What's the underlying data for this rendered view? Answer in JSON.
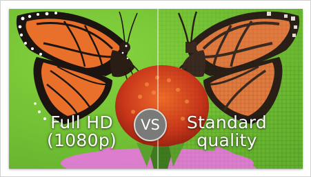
{
  "comparison": {
    "left_label_line1": "Full HD",
    "left_label_line2": "(1080p)",
    "badge": "VS",
    "right_label_line1": "Standard",
    "right_label_line2": "quality"
  },
  "colors": {
    "background_green": "#78c83a",
    "wing_orange": "#e8702a",
    "wing_black": "#1c1410",
    "flower_petal": "#e27ad6",
    "flower_cone": "#d6401a",
    "badge_gray": "#7a7a78"
  },
  "icons": {
    "subject": "butterfly-on-coneflower"
  }
}
